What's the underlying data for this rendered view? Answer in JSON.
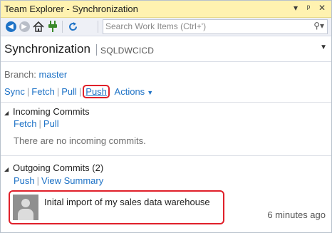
{
  "window": {
    "title": "Team Explorer - Synchronization"
  },
  "titlebar_icons": {
    "dropdown": "chevron-down-icon",
    "pin": "pin-icon",
    "close": "close-icon"
  },
  "toolbar": {
    "icons": [
      "back-icon",
      "forward-icon",
      "home-icon",
      "connect-icon",
      "refresh-icon"
    ],
    "search_placeholder": "Search Work Items (Ctrl+')"
  },
  "header": {
    "title": "Synchronization",
    "context": "SQLDWCICD"
  },
  "branch": {
    "label": "Branch:",
    "name": "master"
  },
  "actions": {
    "sync": "Sync",
    "fetch": "Fetch",
    "pull": "Pull",
    "push": "Push",
    "more": "Actions"
  },
  "incoming": {
    "title": "Incoming Commits",
    "fetch": "Fetch",
    "pull": "Pull",
    "empty_message": "There are no incoming commits."
  },
  "outgoing": {
    "title": "Outgoing Commits (2)",
    "push": "Push",
    "view_summary": "View Summary",
    "commits": [
      {
        "message": "Inital import of my sales data warehouse",
        "time": "6 minutes ago"
      }
    ]
  },
  "colors": {
    "titlebar_bg": "#fff2b0",
    "link": "#1e72c6",
    "highlight": "#e0202a"
  }
}
